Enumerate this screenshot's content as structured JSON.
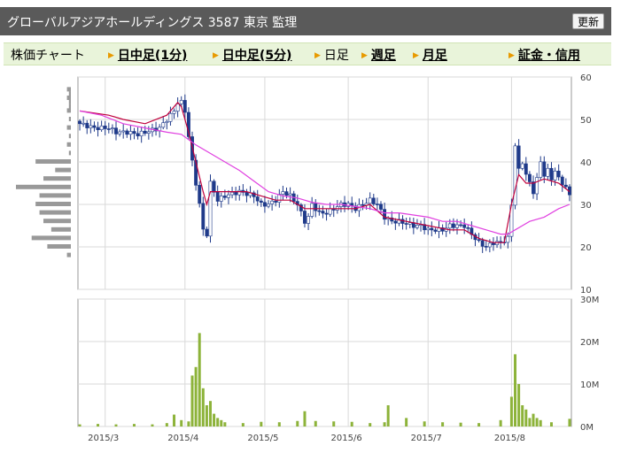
{
  "header": {
    "title": "グローバルアジアホールディングス 3587 東京 監理",
    "refresh_label": "更新"
  },
  "nav": {
    "items": [
      {
        "label": "株価チャート",
        "link": false,
        "arrow": false
      },
      {
        "label": "日中足(1分)",
        "link": true,
        "arrow": true
      },
      {
        "label": "日中足(5分)",
        "link": true,
        "arrow": true
      },
      {
        "label": "日足",
        "link": false,
        "arrow": true
      },
      {
        "label": "週足",
        "link": true,
        "arrow": true
      },
      {
        "label": "月足",
        "link": true,
        "arrow": true
      },
      {
        "label": "証金・信用",
        "link": true,
        "arrow": true
      }
    ]
  },
  "colors": {
    "header_bg": "#5a5a5a",
    "nav_bg": "#e9f4da",
    "candle_down": "#1f3a8a",
    "candle_up": "#ffffff",
    "short_ma": "#c0003c",
    "long_ma": "#e040e0",
    "volume_bar": "#8db33a",
    "profile_bar": "#999999",
    "arrow": "#e89a00"
  },
  "chart_data": [
    {
      "type": "candlestick",
      "ylim": [
        10,
        60
      ],
      "yticks": [
        "60",
        "50",
        "40",
        "30",
        "20",
        "10"
      ],
      "xticks": [
        "2015/3",
        "2015/4",
        "2015/5",
        "2015/6",
        "2015/7",
        "2015/8"
      ],
      "price_path": [
        [
          0,
          49
        ],
        [
          4,
          48
        ],
        [
          6,
          48
        ],
        [
          8,
          48
        ],
        [
          10,
          47
        ],
        [
          13,
          47
        ],
        [
          16,
          46.5
        ],
        [
          20,
          47.5
        ],
        [
          22,
          48
        ],
        [
          24,
          50
        ],
        [
          26,
          52
        ],
        [
          27,
          54
        ],
        [
          28,
          54
        ],
        [
          29,
          52
        ],
        [
          30,
          46
        ],
        [
          31,
          40
        ],
        [
          32,
          35
        ],
        [
          33,
          30
        ],
        [
          34,
          24
        ],
        [
          35,
          23
        ],
        [
          36,
          35
        ],
        [
          37,
          33
        ],
        [
          38,
          31
        ],
        [
          40,
          32
        ],
        [
          44,
          33
        ],
        [
          48,
          32
        ],
        [
          50,
          30
        ],
        [
          52,
          30
        ],
        [
          54,
          31
        ],
        [
          56,
          33
        ],
        [
          58,
          32
        ],
        [
          60,
          30
        ],
        [
          62,
          26
        ],
        [
          63,
          27
        ],
        [
          64,
          30
        ],
        [
          66,
          28
        ],
        [
          68,
          28
        ],
        [
          70,
          29
        ],
        [
          72,
          30
        ],
        [
          74,
          30
        ],
        [
          76,
          29
        ],
        [
          78,
          30
        ],
        [
          80,
          31
        ],
        [
          82,
          30
        ],
        [
          84,
          27
        ],
        [
          86,
          26
        ],
        [
          88,
          26
        ],
        [
          90,
          25.5
        ],
        [
          92,
          25
        ],
        [
          94,
          25
        ],
        [
          96,
          24
        ],
        [
          98,
          24
        ],
        [
          100,
          24
        ],
        [
          102,
          25
        ],
        [
          104,
          25
        ],
        [
          106,
          25
        ],
        [
          108,
          23
        ],
        [
          110,
          21
        ],
        [
          112,
          20
        ],
        [
          114,
          21
        ],
        [
          116,
          21
        ],
        [
          118,
          22
        ],
        [
          119,
          30
        ],
        [
          120,
          44
        ],
        [
          121,
          38
        ],
        [
          122,
          40
        ],
        [
          123,
          37
        ],
        [
          124,
          35
        ],
        [
          125,
          33
        ],
        [
          126,
          36
        ],
        [
          127,
          40
        ],
        [
          128,
          37
        ],
        [
          129,
          38
        ],
        [
          130,
          36
        ],
        [
          131,
          38
        ],
        [
          132,
          36
        ],
        [
          133,
          35
        ],
        [
          134,
          34
        ],
        [
          135,
          32
        ]
      ],
      "series": [
        {
          "type": "line",
          "values": [
            [
              0,
              52
            ],
            [
              8,
              51
            ],
            [
              12,
              50
            ],
            [
              18,
              49
            ],
            [
              24,
              51
            ],
            [
              27,
              54
            ],
            [
              28,
              53
            ],
            [
              30,
              47
            ],
            [
              32,
              40
            ],
            [
              34,
              33
            ],
            [
              35,
              30
            ],
            [
              36,
              33
            ],
            [
              40,
              33
            ],
            [
              46,
              33
            ],
            [
              50,
              32
            ],
            [
              54,
              31
            ],
            [
              58,
              31
            ],
            [
              62,
              29
            ],
            [
              66,
              29
            ],
            [
              70,
              29
            ],
            [
              76,
              29
            ],
            [
              80,
              30
            ],
            [
              84,
              27
            ],
            [
              90,
              26
            ],
            [
              96,
              25
            ],
            [
              102,
              24
            ],
            [
              106,
              24
            ],
            [
              110,
              22
            ],
            [
              114,
              21
            ],
            [
              117,
              21
            ],
            [
              119,
              30
            ],
            [
              121,
              37
            ],
            [
              123,
              35
            ],
            [
              125,
              35
            ],
            [
              128,
              36
            ],
            [
              132,
              35
            ],
            [
              135,
              33
            ]
          ]
        },
        {
          "type": "line",
          "values": [
            [
              0,
              52
            ],
            [
              6,
              51
            ],
            [
              12,
              49
            ],
            [
              18,
              48
            ],
            [
              24,
              47
            ],
            [
              28,
              46.5
            ],
            [
              32,
              44
            ],
            [
              36,
              42
            ],
            [
              40,
              40
            ],
            [
              44,
              38
            ],
            [
              48,
              35.5
            ],
            [
              52,
              33
            ],
            [
              56,
              32
            ],
            [
              60,
              31.5
            ],
            [
              64,
              30.5
            ],
            [
              68,
              30
            ],
            [
              72,
              30
            ],
            [
              76,
              29.5
            ],
            [
              80,
              29
            ],
            [
              84,
              28
            ],
            [
              88,
              28
            ],
            [
              92,
              27.5
            ],
            [
              96,
              27
            ],
            [
              100,
              26
            ],
            [
              104,
              26
            ],
            [
              108,
              25
            ],
            [
              112,
              24
            ],
            [
              116,
              23
            ],
            [
              118,
              23
            ],
            [
              120,
              24
            ],
            [
              124,
              26
            ],
            [
              128,
              27
            ],
            [
              132,
              29
            ],
            [
              135,
              30
            ]
          ]
        }
      ]
    },
    {
      "type": "bar",
      "ylim": [
        0,
        30
      ],
      "yticks": [
        "30M",
        "20M",
        "10M",
        "0M"
      ],
      "x": [
        0,
        5,
        10,
        15,
        20,
        24,
        26,
        28,
        30,
        31,
        32,
        33,
        34,
        35,
        36,
        37,
        38,
        39,
        40,
        45,
        50,
        55,
        60,
        62,
        65,
        70,
        75,
        80,
        84,
        85,
        90,
        95,
        100,
        105,
        110,
        116,
        119,
        120,
        121,
        122,
        123,
        124,
        125,
        126,
        127,
        130,
        135
      ],
      "values": [
        0.5,
        0.6,
        0.5,
        0.6,
        0.5,
        0.8,
        2.8,
        1.5,
        1.2,
        12,
        14,
        22,
        9,
        5,
        6,
        3,
        2,
        1.5,
        1,
        0.8,
        1.1,
        1.0,
        1.3,
        3.6,
        1.3,
        1.2,
        1.1,
        0.8,
        1.0,
        5,
        2,
        1.2,
        1.0,
        0.9,
        0.8,
        1.5,
        7,
        17,
        10,
        5,
        4,
        2,
        3,
        2,
        1.5,
        1.0,
        1.8
      ]
    },
    {
      "type": "bar",
      "orientation": "horizontal",
      "categories": [
        57,
        56,
        55,
        54,
        53,
        52,
        50,
        48,
        46,
        44,
        42,
        40,
        38,
        36,
        34,
        32,
        30,
        28,
        26,
        24,
        22,
        20,
        18
      ],
      "values": [
        1,
        0.5,
        1,
        0.5,
        0.5,
        1,
        0.5,
        1,
        0.5,
        1,
        0.5,
        9,
        4,
        7,
        14,
        8,
        9,
        8,
        7,
        5,
        10,
        6,
        1
      ]
    }
  ]
}
